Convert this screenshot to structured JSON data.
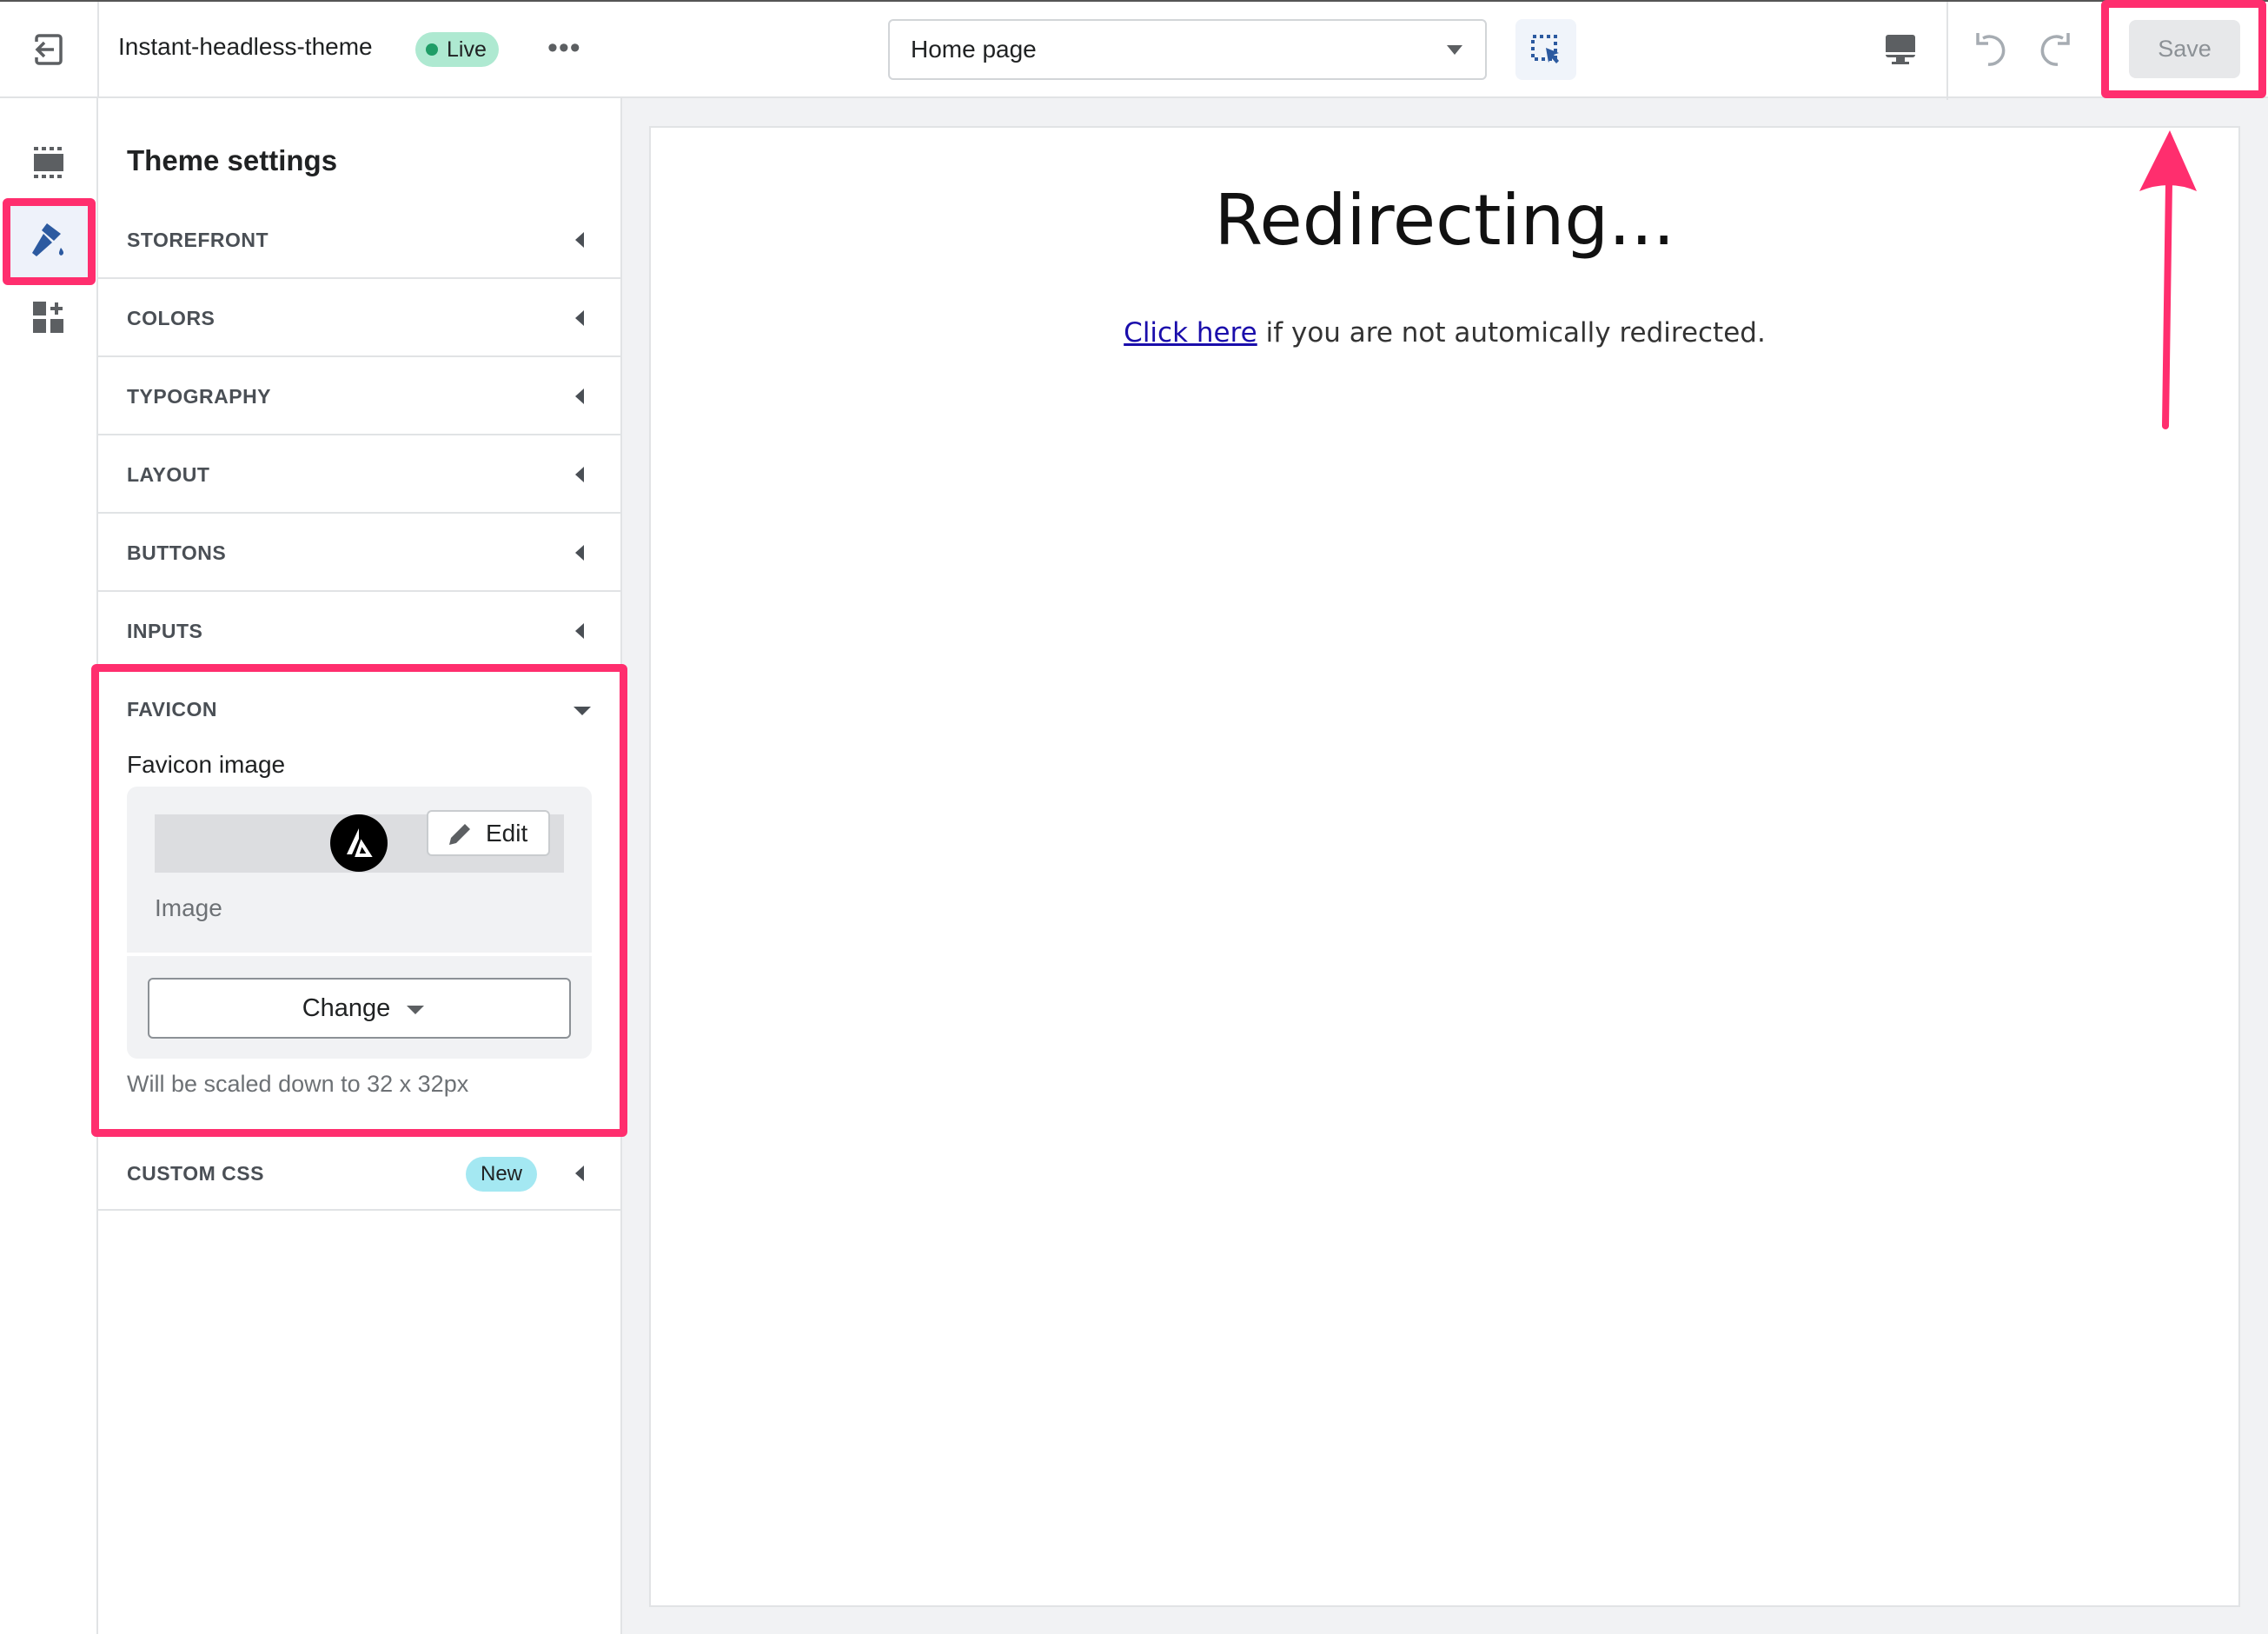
{
  "topbar": {
    "theme_name": "Instant-headless-theme",
    "status_badge": "Live",
    "more_label": "•••",
    "page_select": "Home page",
    "save_label": "Save",
    "icons": [
      "exit-icon",
      "more-icon",
      "chevron-down-icon",
      "select-element-icon",
      "desktop-icon",
      "undo-icon",
      "redo-icon"
    ]
  },
  "rail": {
    "icons": [
      "sections-icon",
      "theme-settings-brush-icon",
      "add-apps-icon"
    ]
  },
  "panel": {
    "heading": "Theme settings",
    "sections": [
      {
        "label": "STOREFRONT"
      },
      {
        "label": "COLORS"
      },
      {
        "label": "TYPOGRAPHY"
      },
      {
        "label": "LAYOUT"
      },
      {
        "label": "BUTTONS"
      },
      {
        "label": "INPUTS"
      }
    ],
    "favicon": {
      "label": "FAVICON",
      "field_label": "Favicon image",
      "edit_label": "Edit",
      "image_caption": "Image",
      "change_label": "Change",
      "hint": "Will be scaled down to 32 x 32px"
    },
    "custom_css": {
      "label": "CUSTOM CSS",
      "badge": "New"
    }
  },
  "preview": {
    "heading": "Redirecting...",
    "link_text": "Click here",
    "message": " if you are not automically redirected."
  },
  "colors": {
    "highlight": "#ff2e6e",
    "accent": "#2c6ecb",
    "live_badge": "#aee9d1",
    "new_badge": "#a4e8f2"
  }
}
